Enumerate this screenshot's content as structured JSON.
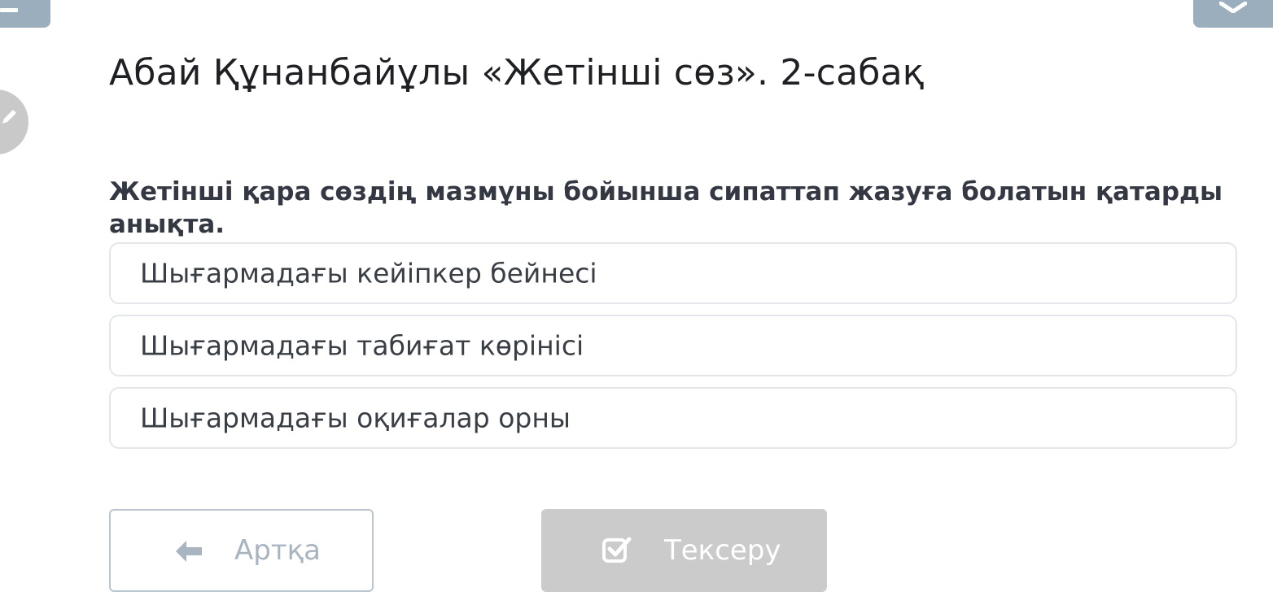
{
  "header": {
    "title": "Абай Құнанбайұлы «Жетінші сөз». 2-сабақ"
  },
  "question": {
    "text": "Жетінші қара сөздің мазмұны бойынша сипаттап жазуға болатын қатарды анықта."
  },
  "options": [
    {
      "label": "Шығармадағы кейіпкер бейнесі"
    },
    {
      "label": "Шығармадағы табиғат көрінісі"
    },
    {
      "label": "Шығармадағы оқиғалар орны"
    }
  ],
  "footer": {
    "back_label": "Артқа",
    "check_label": "Тексеру"
  },
  "icons": {
    "back": "arrow-left-icon",
    "check": "checkbox-check-icon",
    "edit": "pencil-icon",
    "menu": "menu-icon",
    "expand": "chevron-icon"
  },
  "colors": {
    "corner_buttons": "#9aaebd",
    "option_border": "#e3e6ea",
    "back_border": "#b9c6d0",
    "check_bg": "#cbcbcb"
  }
}
